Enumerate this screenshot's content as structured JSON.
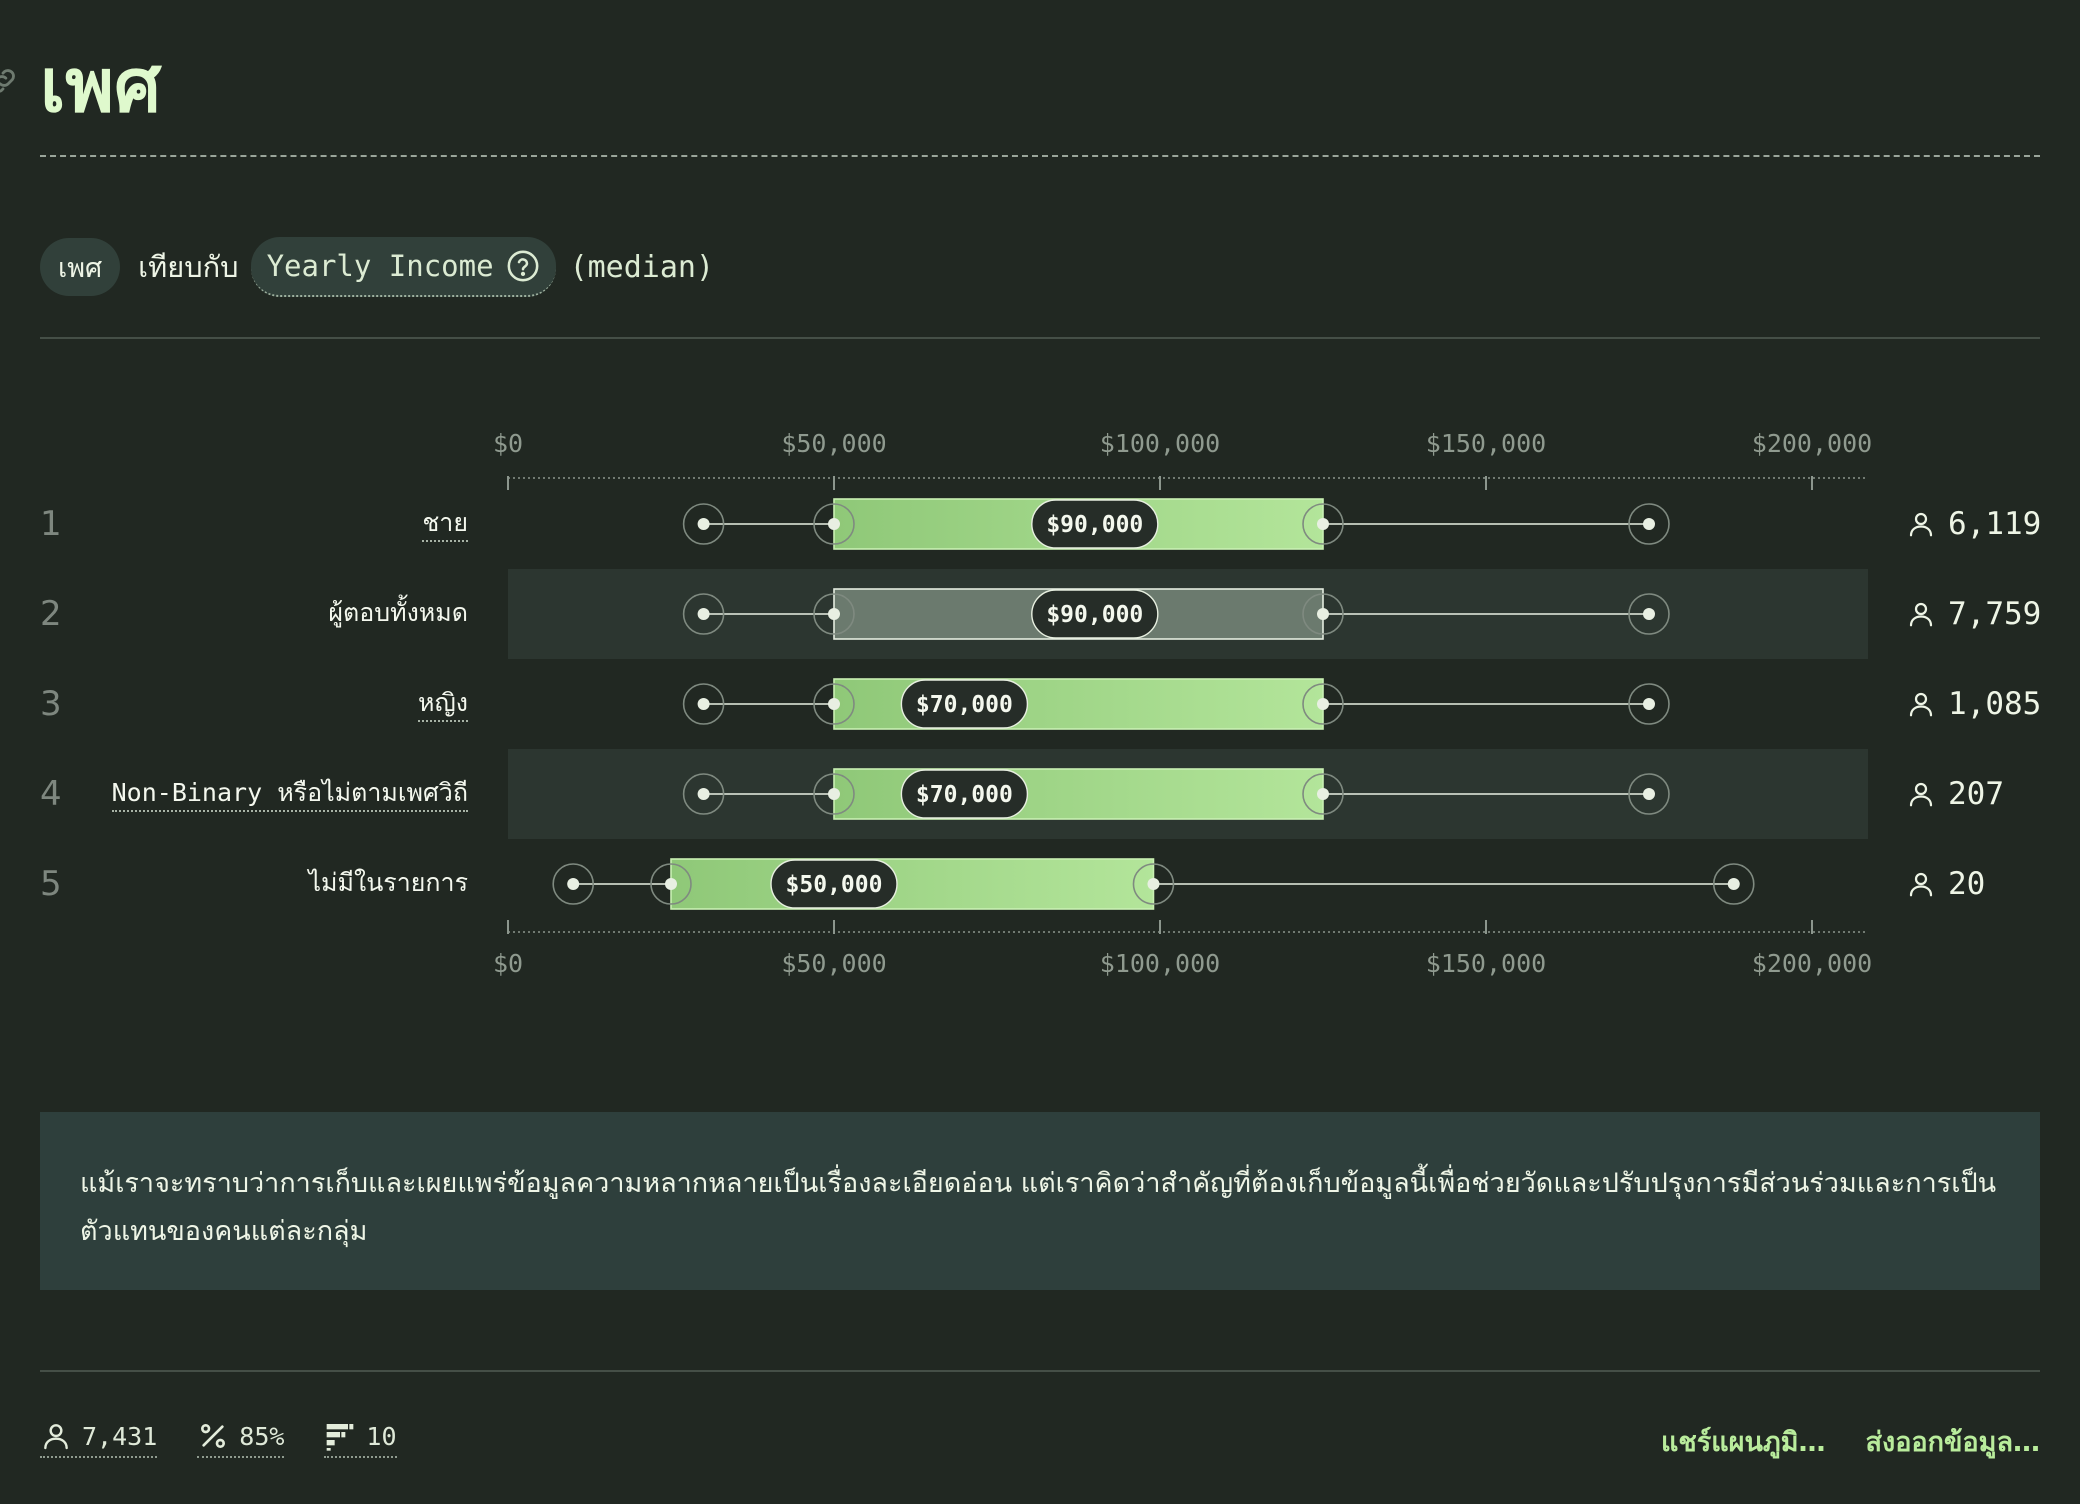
{
  "page": {
    "title": "เพศ",
    "link_icon": "link-icon"
  },
  "subtitle": {
    "group_pill": "เพศ",
    "versus": "เทียบกับ",
    "metric_pill": "Yearly Income",
    "metric_help_icon": "question-circle-icon",
    "aggregation": "(median)"
  },
  "chart_data": {
    "type": "boxplot",
    "x_axis": {
      "range": [
        0,
        225000
      ],
      "ticks": [
        0,
        50000,
        100000,
        150000,
        200000
      ],
      "tick_labels": [
        "$0",
        "$50,000",
        "$100,000",
        "$150,000",
        "$200,000"
      ]
    },
    "rows": [
      {
        "rank": "1",
        "label": "ชาย",
        "min": 30000,
        "q1": 50000,
        "median": 90000,
        "q3": 125000,
        "max": 175000,
        "median_label": "$90,000",
        "count": "6,119",
        "underlined": true,
        "highlight": false,
        "style": "gradient"
      },
      {
        "rank": "2",
        "label": "ผู้ตอบทั้งหมด",
        "min": 30000,
        "q1": 50000,
        "median": 90000,
        "q3": 125000,
        "max": 175000,
        "median_label": "$90,000",
        "count": "7,759",
        "underlined": false,
        "highlight": true,
        "style": "neutral"
      },
      {
        "rank": "3",
        "label": "หญิง",
        "min": 30000,
        "q1": 50000,
        "median": 70000,
        "q3": 125000,
        "max": 175000,
        "median_label": "$70,000",
        "count": "1,085",
        "underlined": true,
        "highlight": false,
        "style": "gradient"
      },
      {
        "rank": "4",
        "label": "Non-Binary หรือไม่ตามเพศวิถี",
        "min": 30000,
        "q1": 50000,
        "median": 70000,
        "q3": 125000,
        "max": 175000,
        "median_label": "$70,000",
        "count": "207",
        "underlined": true,
        "highlight": true,
        "style": "gradient"
      },
      {
        "rank": "5",
        "label": "ไม่มีในรายการ",
        "min": 10000,
        "q1": 25000,
        "median": 50000,
        "q3": 99000,
        "max": 188000,
        "median_label": "$50,000",
        "count": "20",
        "underlined": false,
        "highlight": false,
        "style": "gradient"
      }
    ],
    "count_icon": "person-icon",
    "colors": {
      "box_light": "#b3e59a",
      "box_dark": "#8fc878",
      "box_neutral": "#6b7a6e",
      "median_badge": "#262d28",
      "row_highlight": "#2c3630",
      "whisker": "#e8efe2"
    }
  },
  "note": {
    "text": "แม้เราจะทราบว่าการเก็บและเผยแพร่ข้อมูลความหลากหลายเป็นเรื่องละเอียดอ่อน แต่เราคิดว่าสำคัญที่ต้องเก็บข้อมูลนี้เพื่อช่วยวัดและปรับปรุงการมีส่วนร่วมและการเป็นตัวแทนของคนแต่ละกลุ่ม"
  },
  "footer": {
    "respondents": "7,431",
    "respondents_icon": "person-icon",
    "percent": "85%",
    "percent_icon": "percent-icon",
    "options": "10",
    "options_icon": "bar-list-icon",
    "share_label": "แชร์แผนภูมิ…",
    "export_label": "ส่งออกข้อมูล…"
  }
}
